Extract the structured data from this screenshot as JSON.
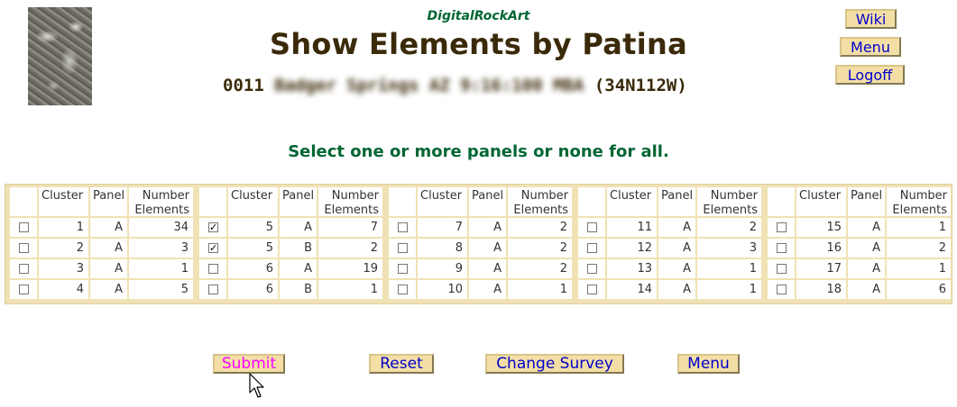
{
  "header": {
    "brand": "DigitalRockArt",
    "title": "Show Elements by Patina",
    "survey_id": "0011",
    "survey_name_blurred": "Badger Springs AZ 9:16:100 MBA",
    "survey_grid": "(34N112W)"
  },
  "nav": {
    "wiki": "Wiki",
    "menu": "Menu",
    "logoff": "Logoff"
  },
  "instruction": "Select one or more panels or none for all.",
  "table": {
    "headers": {
      "cluster": "Cluster",
      "panel": "Panel",
      "number_line1": "Number",
      "number_line2": "Elements"
    },
    "groups": [
      {
        "rows": [
          {
            "checked": false,
            "cluster": "1",
            "panel": "A",
            "count": "34"
          },
          {
            "checked": false,
            "cluster": "2",
            "panel": "A",
            "count": "3"
          },
          {
            "checked": false,
            "cluster": "3",
            "panel": "A",
            "count": "1"
          },
          {
            "checked": false,
            "cluster": "4",
            "panel": "A",
            "count": "5"
          }
        ]
      },
      {
        "rows": [
          {
            "checked": true,
            "cluster": "5",
            "panel": "A",
            "count": "7"
          },
          {
            "checked": true,
            "cluster": "5",
            "panel": "B",
            "count": "2"
          },
          {
            "checked": false,
            "cluster": "6",
            "panel": "A",
            "count": "19"
          },
          {
            "checked": false,
            "cluster": "6",
            "panel": "B",
            "count": "1"
          }
        ]
      },
      {
        "rows": [
          {
            "checked": false,
            "cluster": "7",
            "panel": "A",
            "count": "2"
          },
          {
            "checked": false,
            "cluster": "8",
            "panel": "A",
            "count": "2"
          },
          {
            "checked": false,
            "cluster": "9",
            "panel": "A",
            "count": "2"
          },
          {
            "checked": false,
            "cluster": "10",
            "panel": "A",
            "count": "1"
          }
        ]
      },
      {
        "rows": [
          {
            "checked": false,
            "cluster": "11",
            "panel": "A",
            "count": "2"
          },
          {
            "checked": false,
            "cluster": "12",
            "panel": "A",
            "count": "3"
          },
          {
            "checked": false,
            "cluster": "13",
            "panel": "A",
            "count": "1"
          },
          {
            "checked": false,
            "cluster": "14",
            "panel": "A",
            "count": "1"
          }
        ]
      },
      {
        "rows": [
          {
            "checked": false,
            "cluster": "15",
            "panel": "A",
            "count": "1"
          },
          {
            "checked": false,
            "cluster": "16",
            "panel": "A",
            "count": "2"
          },
          {
            "checked": false,
            "cluster": "17",
            "panel": "A",
            "count": "1"
          },
          {
            "checked": false,
            "cluster": "18",
            "panel": "A",
            "count": "6"
          }
        ]
      }
    ]
  },
  "actions": {
    "submit": "Submit",
    "reset": "Reset",
    "change_survey": "Change Survey",
    "menu": "Menu"
  },
  "colors": {
    "button_bg": "#f3dfa6",
    "link": "#0000cc",
    "submit_text": "#ff00ff",
    "title": "#3b2a0a",
    "accent_green": "#006633",
    "table_border": "#f0e2b4"
  }
}
